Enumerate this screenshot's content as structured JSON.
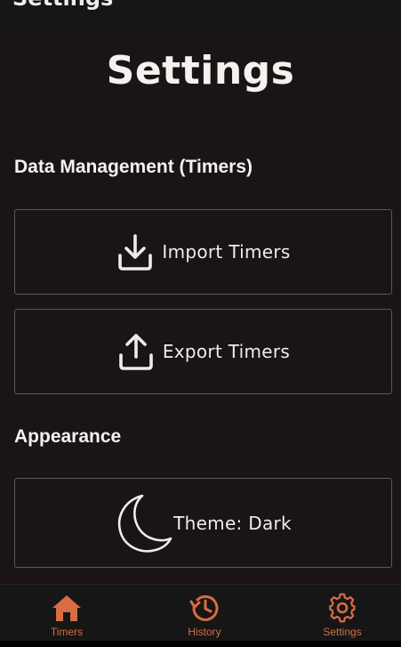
{
  "header": {
    "title": "Settings"
  },
  "page": {
    "title": "Settings"
  },
  "sections": {
    "data_management": {
      "heading": "Data Management (Timers)",
      "import_label": "Import Timers",
      "import_icon": "download-icon",
      "export_label": "Export Timers",
      "export_icon": "upload-icon"
    },
    "appearance": {
      "heading": "Appearance",
      "theme_label": "Theme: Dark",
      "theme_icon": "moon-icon"
    }
  },
  "bottom_nav": {
    "items": [
      {
        "label": "Timers",
        "icon": "home-icon"
      },
      {
        "label": "History",
        "icon": "history-icon"
      },
      {
        "label": "Settings",
        "icon": "gear-icon"
      }
    ]
  },
  "colors": {
    "background": "#1a1416",
    "accent": "#d86c43",
    "text": "#f1ece9",
    "border": "#5d5758"
  }
}
